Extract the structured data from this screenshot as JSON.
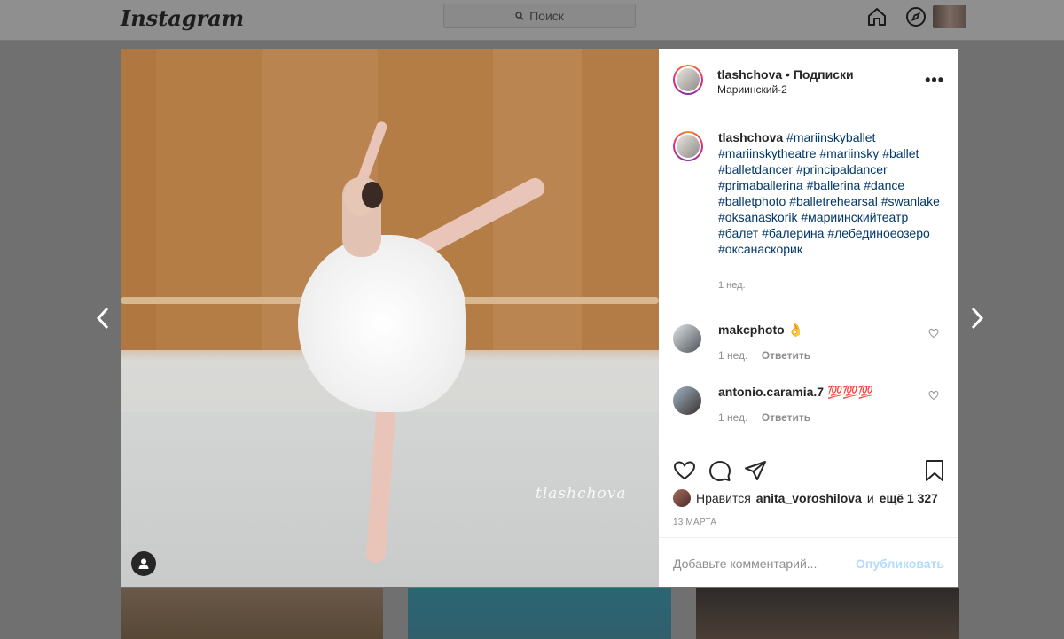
{
  "topbar": {
    "logo": "Instagram",
    "search_placeholder": "Поиск",
    "icons": [
      "home-icon",
      "explore-icon",
      "activity-heart-icon"
    ]
  },
  "post": {
    "username": "tlashchova",
    "follow_label": "Подписки",
    "separator": "•",
    "location": "Мариинский-2",
    "more_label": "•••",
    "watermark": "tlashchova",
    "caption": {
      "username": "tlashchova",
      "hashtags": [
        "#mariinskyballet",
        "#mariinskytheatre",
        "#mariinsky",
        "#ballet",
        "#balletdancer",
        "#principaldancer",
        "#primaballerina",
        "#ballerina",
        "#dance",
        "#balletphoto",
        "#balletrehearsal",
        "#swanlake",
        "#oksanaskorik",
        "#мариинскийтеатр",
        "#балет",
        "#балерина",
        "#лебединоеозеро",
        "#оксанаскорик"
      ],
      "time": "1 нед."
    },
    "comments": [
      {
        "username": "makcphoto",
        "text": "👌",
        "time": "1 нед.",
        "reply": "Ответить"
      },
      {
        "username": "antonio.caramia.7",
        "text": "💯💯💯",
        "time": "1 нед.",
        "reply": "Ответить"
      }
    ],
    "likes": {
      "prefix": "Нравится",
      "user": "anita_voroshilova",
      "mid": "и",
      "more": "ещё 1 327"
    },
    "date": "13 МАРТА",
    "add_comment_placeholder": "Добавьте комментарий...",
    "post_button": "Опубликовать"
  },
  "nav": {
    "prev": "‹",
    "next": "›"
  }
}
